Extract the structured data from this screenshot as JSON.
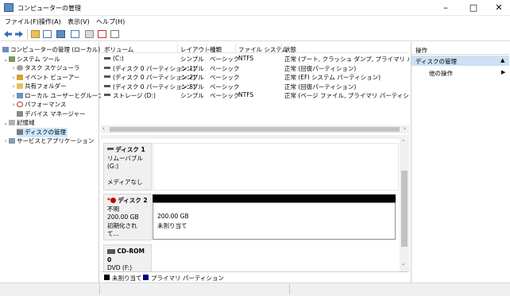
{
  "window": {
    "title": "コンピューターの管理",
    "minimize_glyph": "–",
    "maximize_glyph": "□",
    "close_glyph": "✕"
  },
  "menu": [
    "ファイル(F)",
    "操作(A)",
    "表示(V)",
    "ヘルプ(H)"
  ],
  "tree": {
    "root": "コンピューターの管理 (ローカル)",
    "system_tools": "システム ツール",
    "task_scheduler": "タスク スケジューラ",
    "event_viewer": "イベント ビューアー",
    "shared_folders": "共有フォルダー",
    "local_users": "ローカル ユーザーとグループ",
    "performance": "パフォーマンス",
    "device_manager": "デバイス マネージャー",
    "storage": "記憶域",
    "disk_management": "ディスクの管理",
    "services_apps": "サービスとアプリケーション"
  },
  "table": {
    "headers": [
      "ボリューム",
      "レイアウト",
      "種類",
      "ファイル システム",
      "状態"
    ],
    "rows": [
      {
        "volume": "(C:)",
        "layout": "シンプル",
        "type": "ベーシック",
        "fs": "NTFS",
        "status": "正常 (ブート, クラッシュ ダンプ, プライマリ パーティション)"
      },
      {
        "volume": "(ディスク 0 パーティション 1)",
        "layout": "シンプル",
        "type": "ベーシック",
        "fs": "",
        "status": "正常 (回復パーティション)"
      },
      {
        "volume": "(ディスク 0 パーティション 2)",
        "layout": "シンプル",
        "type": "ベーシック",
        "fs": "",
        "status": "正常 (EFI システム パーティション)"
      },
      {
        "volume": "(ディスク 0 パーティション 5)",
        "layout": "シンプル",
        "type": "ベーシック",
        "fs": "",
        "status": "正常 (回復パーティション)"
      },
      {
        "volume": "ストレージ (D:)",
        "layout": "シンプル",
        "type": "ベーシック",
        "fs": "NTFS",
        "status": "正常 (ページ ファイル, プライマリ パーティション)"
      }
    ]
  },
  "disks": {
    "disk1": {
      "name": "ディスク 1",
      "type": "リムーバブル (G:)",
      "state": "メディアなし"
    },
    "disk2": {
      "name": "ディスク 2",
      "type": "不明",
      "size": "200.00 GB",
      "state": "初期化されて...",
      "partition_size": "200.00 GB",
      "partition_state": "未割り当て"
    },
    "cdrom0": {
      "name": "CD-ROM 0",
      "type": "DVD (F:)"
    }
  },
  "legend": {
    "unallocated": "未割り当て",
    "primary": "プライマリ パーティション",
    "colors": {
      "unallocated": "#000000",
      "primary": "#00007f"
    }
  },
  "actions": {
    "header": "操作",
    "section": "ディスクの管理",
    "other": "他の操作"
  }
}
